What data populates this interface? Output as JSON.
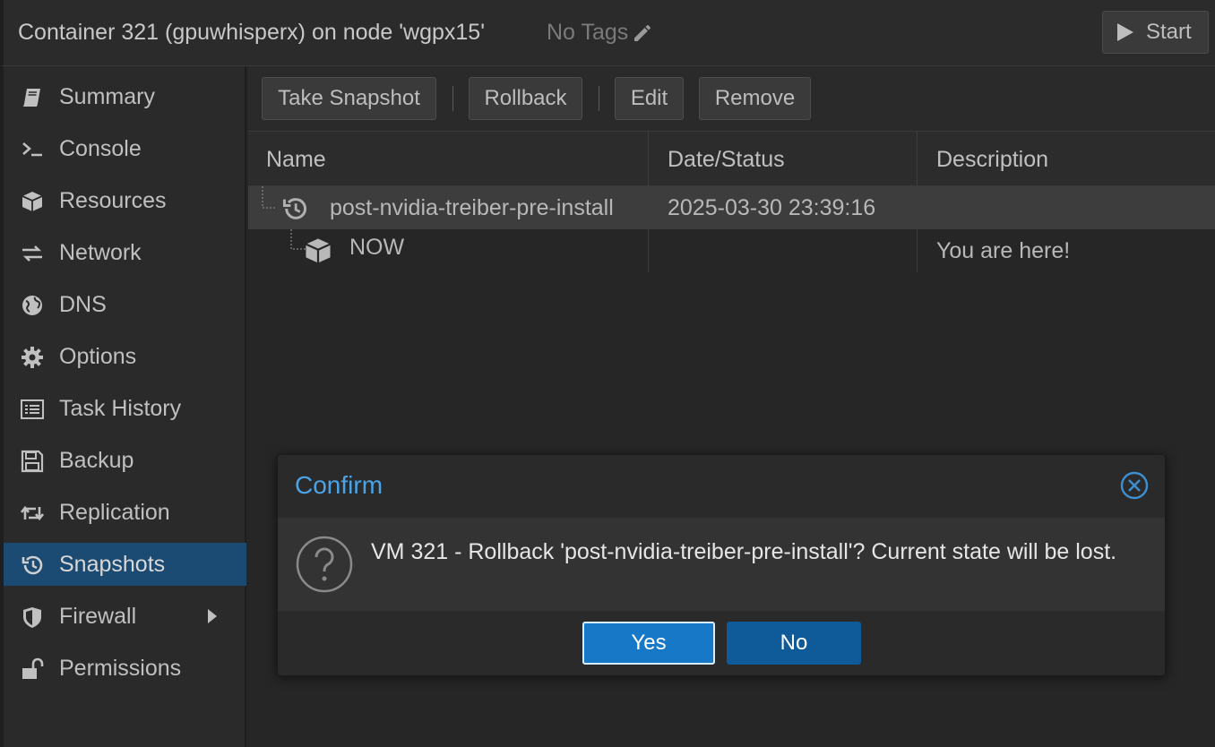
{
  "header": {
    "title": "Container 321 (gpuwhisperx) on node 'wgpx15'",
    "tags_label": "No Tags",
    "start_label": "Start"
  },
  "sidebar": {
    "items": [
      {
        "label": "Summary",
        "icon": "book-icon"
      },
      {
        "label": "Console",
        "icon": "terminal-icon"
      },
      {
        "label": "Resources",
        "icon": "cube-icon"
      },
      {
        "label": "Network",
        "icon": "exchange-icon"
      },
      {
        "label": "DNS",
        "icon": "globe-icon"
      },
      {
        "label": "Options",
        "icon": "gear-icon"
      },
      {
        "label": "Task History",
        "icon": "list-icon"
      },
      {
        "label": "Backup",
        "icon": "floppy-icon"
      },
      {
        "label": "Replication",
        "icon": "retweet-icon"
      },
      {
        "label": "Snapshots",
        "icon": "history-icon",
        "active": true
      },
      {
        "label": "Firewall",
        "icon": "shield-icon"
      },
      {
        "label": "Permissions",
        "icon": "unlock-icon"
      }
    ]
  },
  "toolbar": {
    "take_snapshot": "Take Snapshot",
    "rollback": "Rollback",
    "edit": "Edit",
    "remove": "Remove"
  },
  "grid": {
    "columns": [
      "Name",
      "Date/Status",
      "Description"
    ],
    "rows": [
      {
        "name": "post-nvidia-treiber-pre-install",
        "date": "2025-03-30 23:39:16",
        "description": ""
      },
      {
        "name": "NOW",
        "date": "",
        "description": "You are here!"
      }
    ]
  },
  "dialog": {
    "title": "Confirm",
    "message": "VM 321 - Rollback 'post-nvidia-treiber-pre-install'? Current state will be lost.",
    "yes_label": "Yes",
    "no_label": "No"
  },
  "colors": {
    "accent": "#4aa3e6",
    "active_nav": "#1b4a72",
    "primary_button": "#1878c8"
  }
}
